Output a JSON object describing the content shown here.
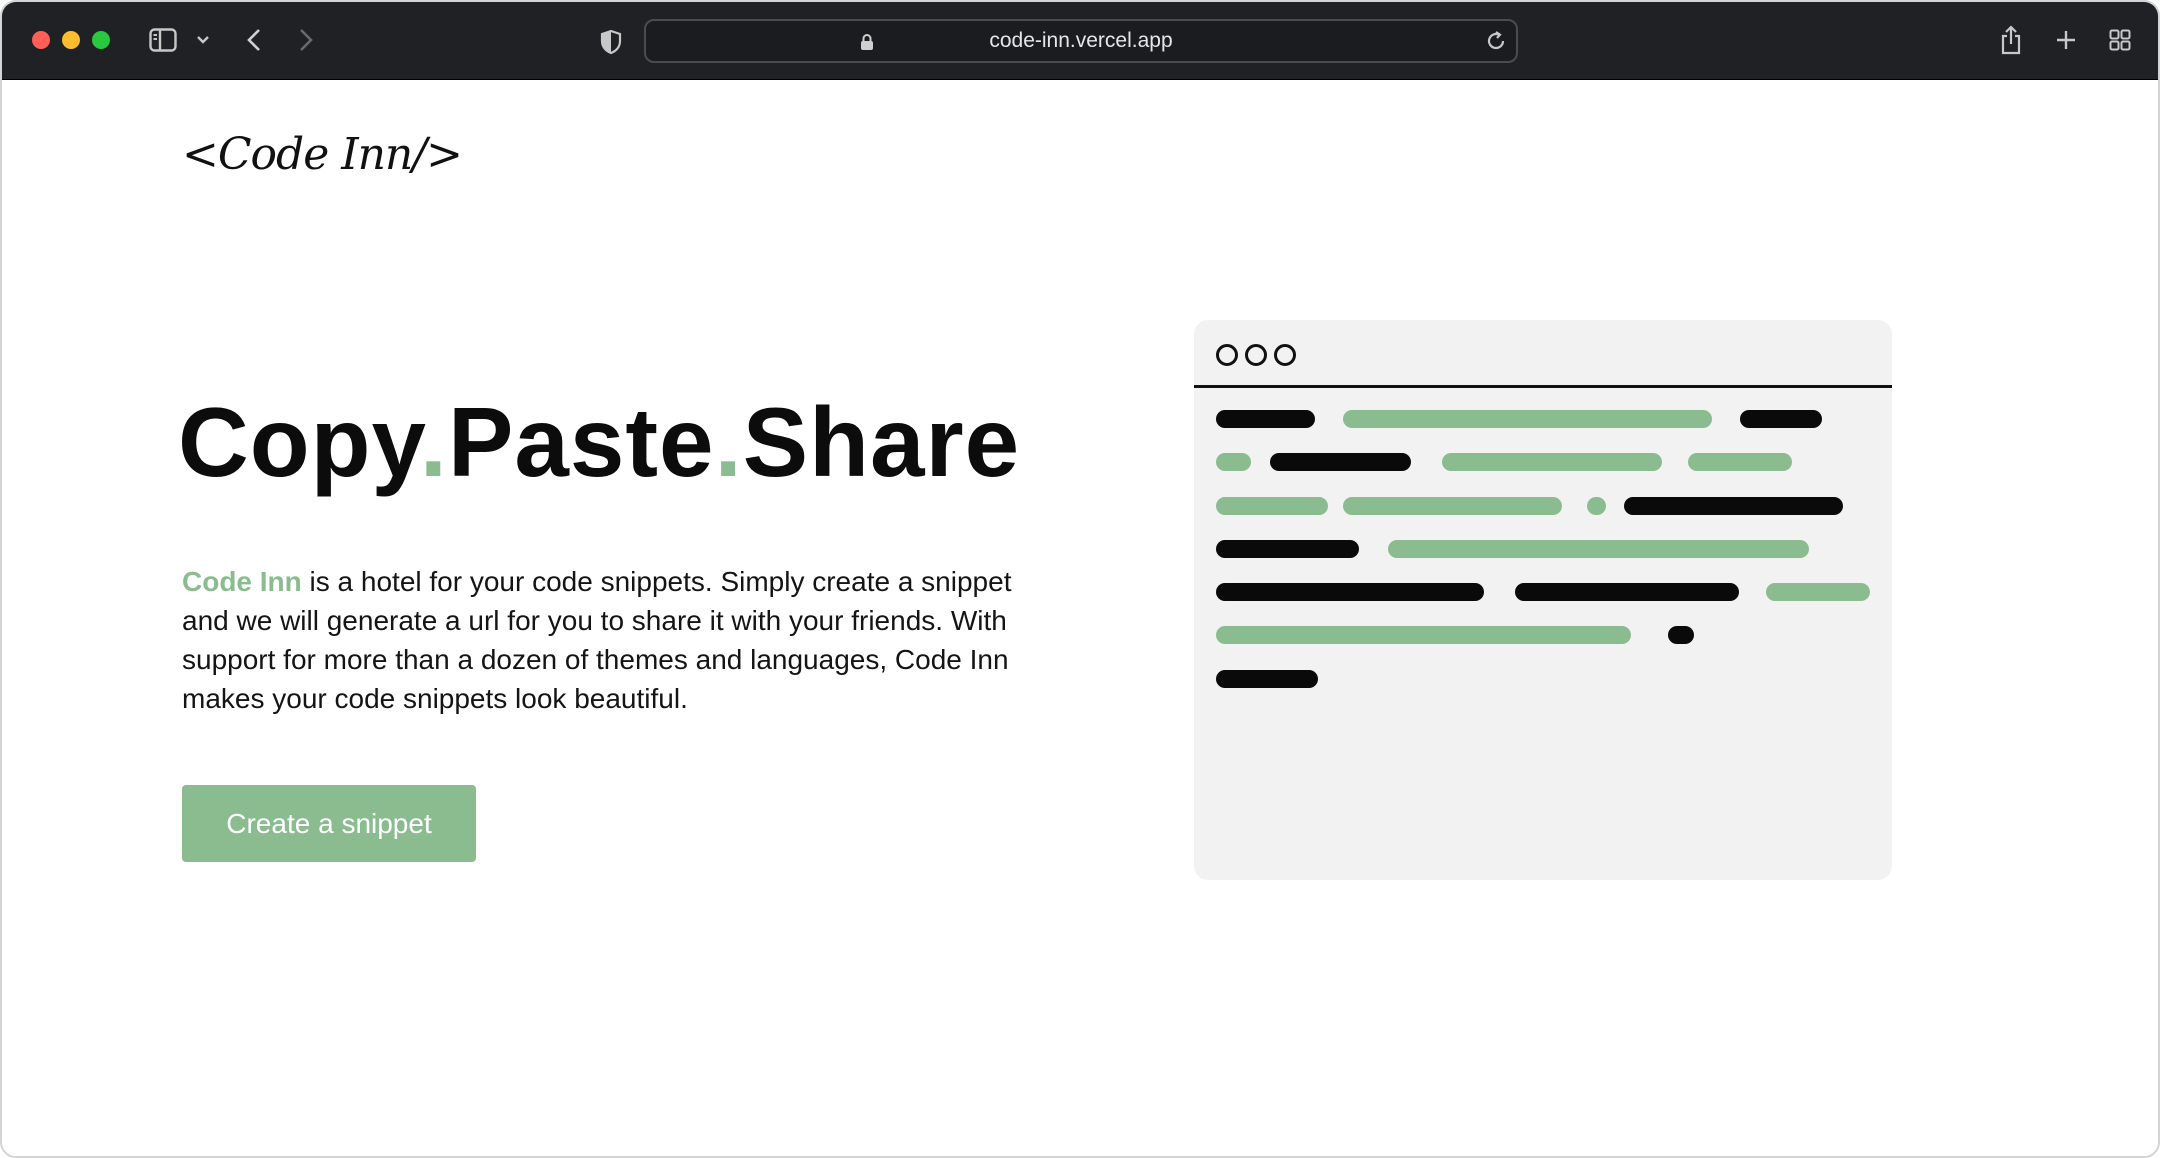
{
  "browser": {
    "url": "code-inn.vercel.app"
  },
  "page": {
    "logo": "<Code Inn/>",
    "headline": {
      "word1": "Copy",
      "dot1": ".",
      "word2": "Paste",
      "dot2": ".",
      "word3": "Share"
    },
    "description": {
      "brand": "Code Inn",
      "text": " is a hotel for your code snippets. Simply create a snippet and we will generate a url for you to share it with your friends. With support for more than a dozen of themes and languages, Code Inn makes your code snippets look beautiful."
    },
    "cta_label": "Create a snippet"
  },
  "colors": {
    "accent": "#8bbc90",
    "text": "#0c0c0c",
    "toolbar": "#1f2124",
    "illustration_bg": "#f2f2f2"
  },
  "icons": [
    "sidebar-icon",
    "chevron-down-icon",
    "back-icon",
    "forward-icon",
    "shield-icon",
    "lock-icon",
    "reload-icon",
    "share-icon",
    "plus-icon",
    "tabs-grid-icon"
  ]
}
